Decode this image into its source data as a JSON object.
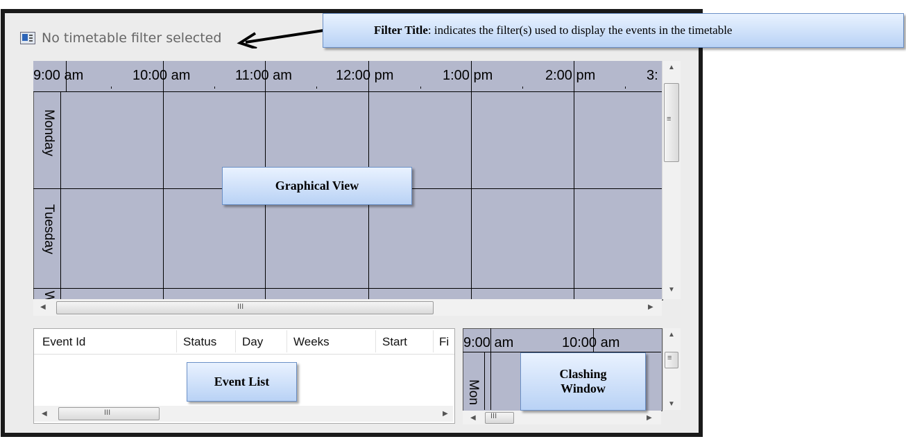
{
  "filter": {
    "title": "No timetable filter selected"
  },
  "callouts": {
    "filter_title": {
      "bold": "Filter Title",
      "text": ": indicates the filter(s) used to display the events in the timetable"
    },
    "graphical_view": "Graphical View",
    "event_list": "Event List",
    "clashing_window": {
      "line1": "Clashing",
      "line2": "Window"
    }
  },
  "graphical_view": {
    "times": [
      "9:00 am",
      "10:00 am",
      "11:00 am",
      "12:00 pm",
      "1:00 pm",
      "2:00 pm",
      "3:"
    ],
    "days": [
      "Monday",
      "Tuesday",
      "W"
    ]
  },
  "event_list": {
    "columns": [
      "Event Id",
      "Status",
      "Day",
      "Weeks",
      "Start",
      "Fi"
    ]
  },
  "clashing_window": {
    "times": [
      "9:00 am",
      "10:00 am"
    ],
    "days": [
      "Mon"
    ]
  },
  "scrollbars": {
    "grip": "III",
    "vgrip": "≡"
  },
  "colors": {
    "grid_bg": "#b4b8cc",
    "callout_border": "#6a8fc6",
    "window_frame": "#1a1a1a"
  }
}
